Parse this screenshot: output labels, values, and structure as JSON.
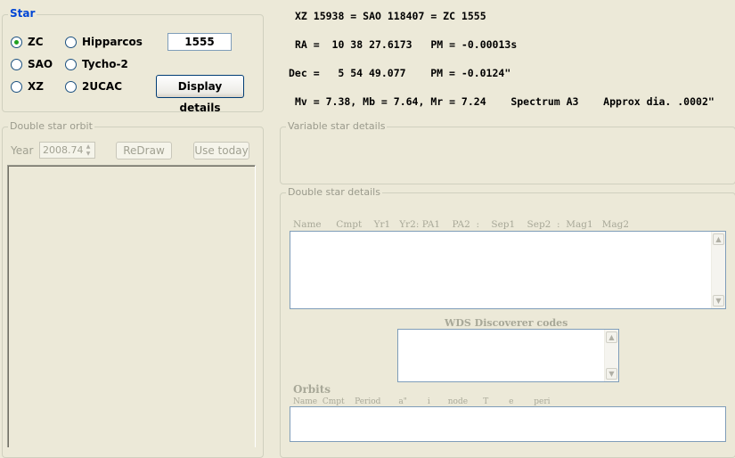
{
  "star_group": {
    "title": "Star",
    "options": [
      {
        "label": "ZC",
        "selected": true
      },
      {
        "label": "Hipparcos",
        "selected": false
      },
      {
        "label": "SAO",
        "selected": false
      },
      {
        "label": "Tycho-2",
        "selected": false
      },
      {
        "label": "XZ",
        "selected": false
      },
      {
        "label": "2UCAC",
        "selected": false
      }
    ],
    "star_number": "1555",
    "display_button": "Display details"
  },
  "star_info": {
    "line1": "XZ 15938 = SAO 118407 = ZC 1555",
    "line2": "RA =  10 38 27.6173   PM = -0.00013s",
    "line3": "Dec =   5 54 49.077    PM = -0.0124\"",
    "line4": "Mv = 7.38, Mb = 7.64, Mr = 7.24    Spectrum A3    Approx dia. .0002\""
  },
  "orbit_group": {
    "title": "Double star orbit",
    "year_label": "Year",
    "year_value": "2008.74",
    "redraw_button": "ReDraw",
    "use_today_button": "Use today"
  },
  "variable_group": {
    "title": "Variable star details"
  },
  "double_group": {
    "title": "Double star details",
    "columns_header": "Name     Cmpt    Yr1   Yr2: PA1    PA2  :    Sep1    Sep2  :  Mag1   Mag2",
    "wds_label": "WDS Discoverer codes",
    "orbits_label": "Orbits",
    "orbits_header": "Name  Cmpt    Period       a\"        i       node      T        e        peri"
  },
  "colors": {
    "window_bg": "#ece9d8",
    "group_title_blue": "#0046d5",
    "radio_selected": "#21a121",
    "disabled_text": "#a1a192"
  }
}
